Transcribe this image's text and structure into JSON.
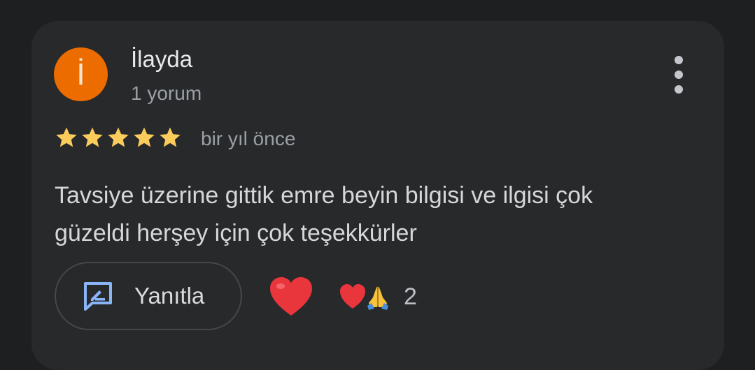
{
  "review": {
    "avatar_initial": "İ",
    "author_name": "İlayda",
    "author_review_count": "1 yorum",
    "rating": 5,
    "rating_max": 5,
    "time_ago": "bir yıl önce",
    "text": "Tavsiye üzerine gittik emre beyin bilgisi ve ilgisi çok güzeldi herşey için çok teşekkürler"
  },
  "actions": {
    "reply_label": "Yanıtla",
    "reaction_count": "2"
  },
  "icons": {
    "more": "more-vert-icon",
    "star": "star-icon",
    "reply": "reply-icon",
    "heart": "red-heart-icon",
    "pray": "folded-hands-icon"
  },
  "colors": {
    "background": "#1e1f21",
    "card": "#28292b",
    "avatar": "#ec6c00",
    "star": "#fbcc5b",
    "reply_icon": "#8ab4f8",
    "heart": "#e8363c"
  }
}
